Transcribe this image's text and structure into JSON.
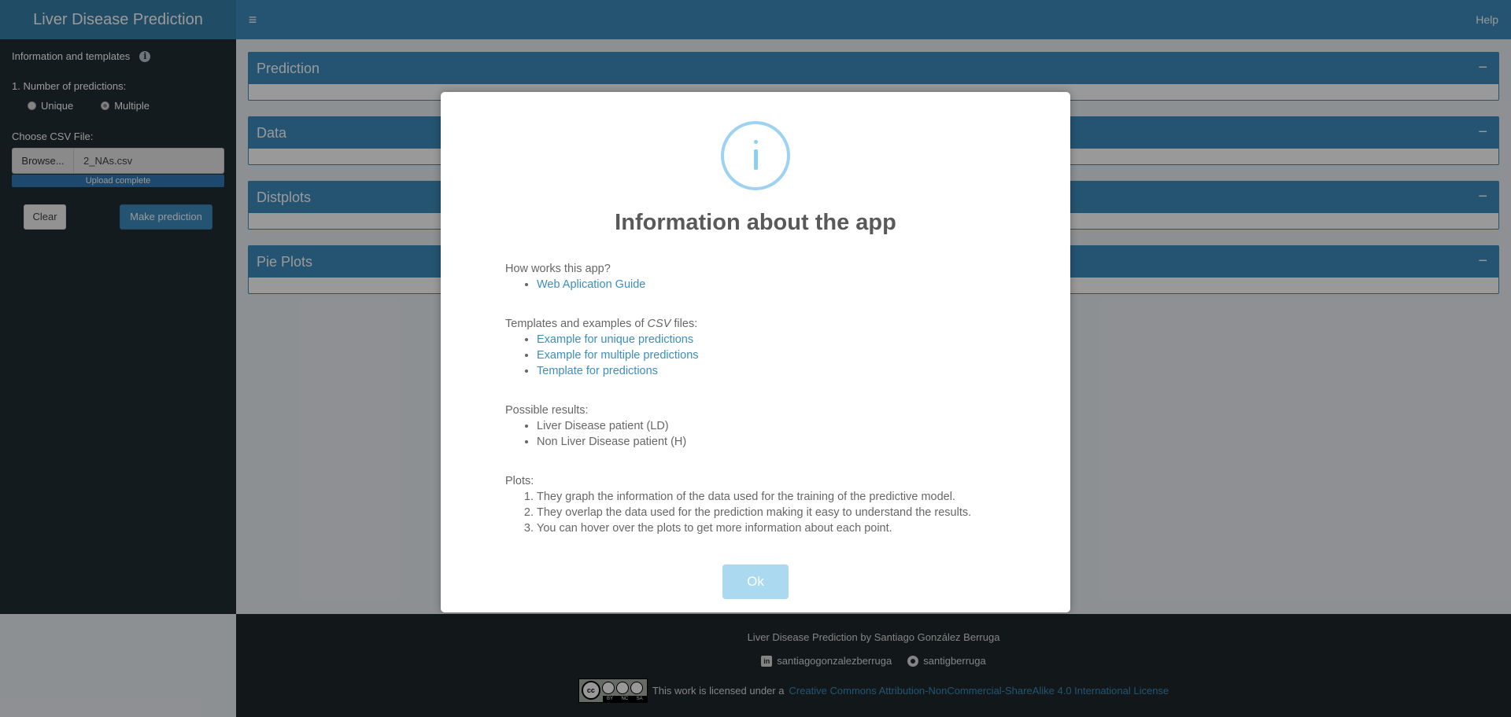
{
  "header": {
    "app_title": "Liver Disease Prediction",
    "toggle_glyph": "≡",
    "help_label": "Help"
  },
  "sidebar": {
    "info_label": "Information and templates",
    "info_icon": "info-icon",
    "num_predictions_label": "1. Number of predictions:",
    "radio_options": [
      "Unique",
      "Multiple"
    ],
    "selected_radio": "Multiple",
    "csv_label": "Choose CSV File:",
    "browse_label": "Browse...",
    "file_name": "2_NAs.csv",
    "upload_status": "Upload complete",
    "clear_label": "Clear",
    "predict_label": "Make prediction"
  },
  "content": {
    "boxes": [
      {
        "title": "Prediction",
        "collapse": "−"
      },
      {
        "title": "Data",
        "collapse": "−"
      },
      {
        "title": "Distplots",
        "collapse": "−"
      },
      {
        "title": "Pie Plots",
        "collapse": "−"
      }
    ]
  },
  "footer": {
    "author_line": "Liver Disease Prediction by Santiago González Berruga",
    "linkedin": "santiagogonzalezberruga",
    "github": "santigberruga",
    "license_prefix": "This work is licensed under a",
    "license_link": "Creative Commons Attribution-NonCommercial-ShareAlike 4.0 International License",
    "cc_badge": {
      "logo": "cc",
      "strip": [
        "BY",
        "NC",
        "SA"
      ]
    }
  },
  "modal": {
    "title": "Information about the app",
    "how_label": "How works this app?",
    "how_links": [
      "Web Aplication Guide"
    ],
    "templates_prefix": "Templates and examples of",
    "templates_em": "CSV",
    "templates_suffix": "files:",
    "template_links": [
      "Example for unique predictions",
      "Example for multiple predictions",
      "Template for predictions"
    ],
    "results_label": "Possible results:",
    "results": [
      "Liver Disease patient (LD)",
      "Non Liver Disease patient (H)"
    ],
    "plots_label": "Plots:",
    "plots": [
      "They graph the information of the data used for the training of the predictive model.",
      "They overlap the data used for the prediction making it easy to understand the results.",
      "You can hover over the plots to get more information about each point."
    ],
    "ok_label": "Ok"
  },
  "colors": {
    "accent": "#3c8dbc",
    "sidebar_bg": "#222d32",
    "ok_button": "#aad9f0"
  }
}
